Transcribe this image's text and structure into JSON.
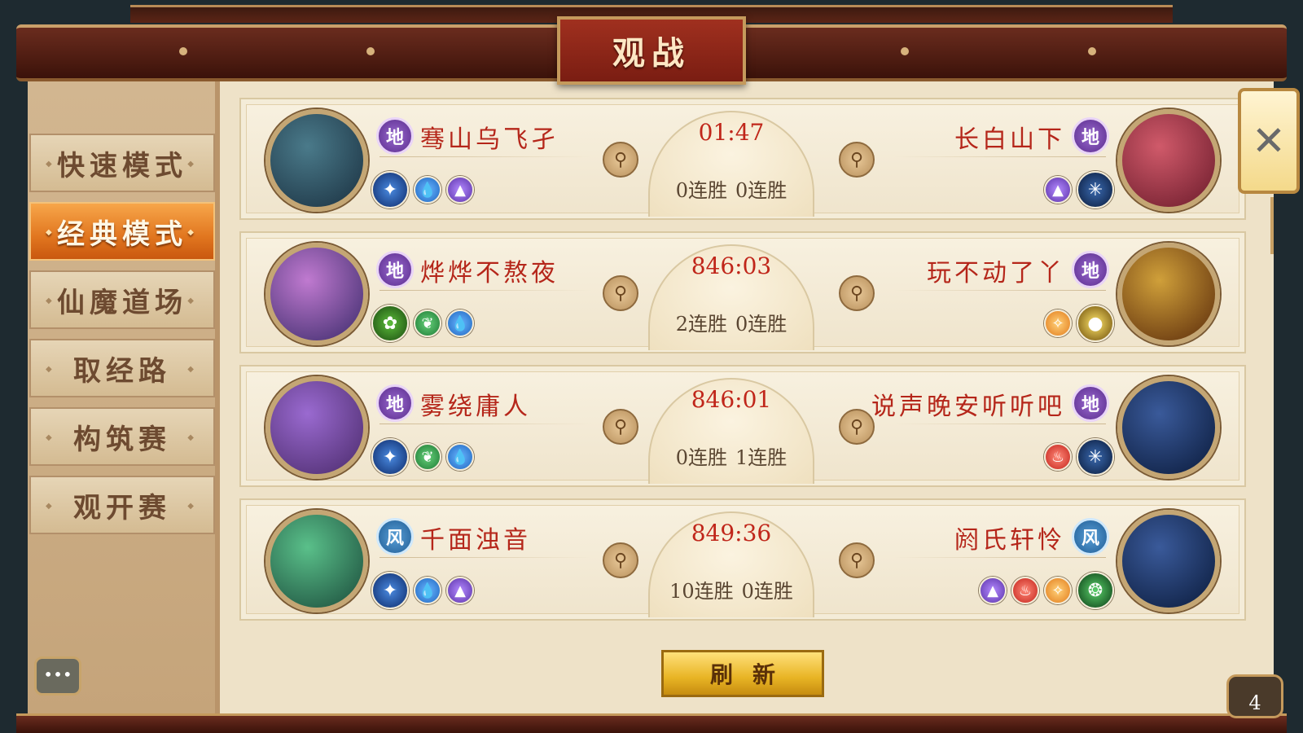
{
  "title": "观战",
  "tabs": [
    {
      "label": "快速模式"
    },
    {
      "label": "经典模式"
    },
    {
      "label": "仙魔道场"
    },
    {
      "label": "取经路"
    },
    {
      "label": "构筑赛"
    },
    {
      "label": "观开赛"
    }
  ],
  "active_tab": "经典模式",
  "matches": [
    {
      "timer": "01:47",
      "left": {
        "rank": "地",
        "name": "骞山乌飞孑",
        "streak": "0连胜",
        "icons": [
          "beast-icon",
          "water-icon",
          "mountain-icon"
        ]
      },
      "right": {
        "rank": "地",
        "name": "长白山下",
        "streak": "0连胜",
        "icons": [
          "mountain-icon",
          "spider-icon"
        ]
      }
    },
    {
      "timer": "846:03",
      "left": {
        "rank": "地",
        "name": "烨烨不熬夜",
        "streak": "2连胜",
        "icons": [
          "tree-icon",
          "leaf-icon",
          "water-icon"
        ]
      },
      "right": {
        "rank": "地",
        "name": "玩不动了丫",
        "streak": "0连胜",
        "icons": [
          "star-icon",
          "eye-icon"
        ]
      }
    },
    {
      "timer": "846:01",
      "left": {
        "rank": "地",
        "name": "雾绕庸人",
        "streak": "0连胜",
        "icons": [
          "beast-icon",
          "leaf-icon",
          "water-icon"
        ]
      },
      "right": {
        "rank": "地",
        "name": "说声晚安听听吧",
        "streak": "1连胜",
        "icons": [
          "fire-icon",
          "spider-icon"
        ]
      }
    },
    {
      "timer": "849:36",
      "left": {
        "rank": "风",
        "name": "千面浊音",
        "streak": "10连胜",
        "icons": [
          "beast-icon",
          "water-icon",
          "mountain-icon"
        ]
      },
      "right": {
        "rank": "风",
        "name": "阏氏轩怜",
        "streak": "0连胜",
        "icons": [
          "mountain-icon",
          "fire-icon",
          "star-icon",
          "dragon-icon"
        ]
      }
    }
  ],
  "refresh_label": "刷新",
  "close_symbol": "✕",
  "chat_symbol": "•••",
  "badge_count": "4",
  "colors": {
    "accent": "#e1761f",
    "name_red": "#b5261a",
    "gold": "#e8b424"
  }
}
